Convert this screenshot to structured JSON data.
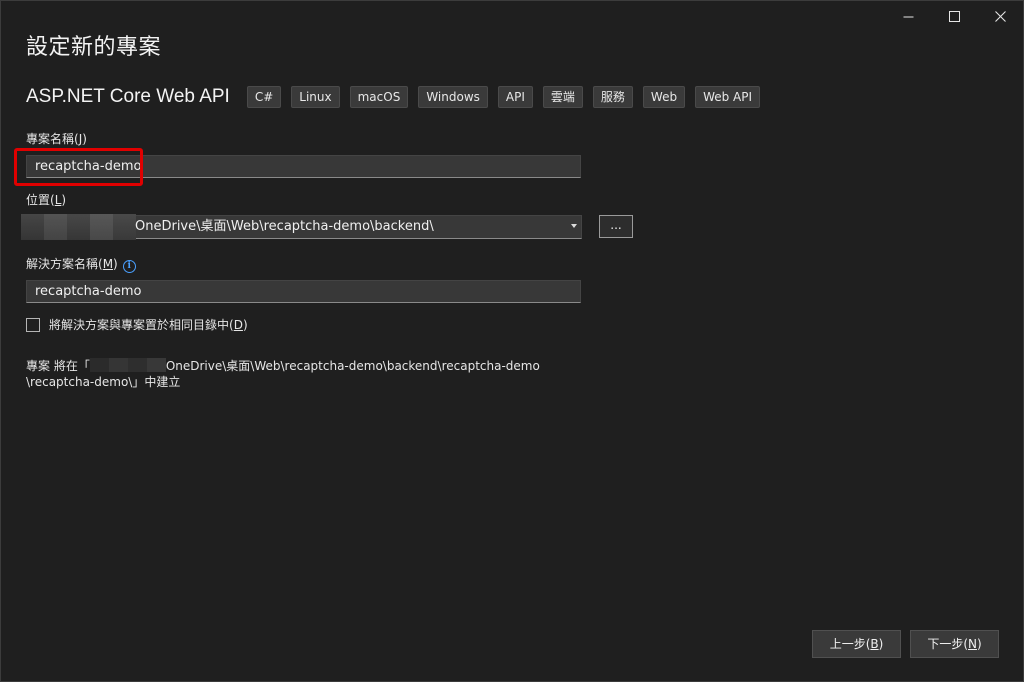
{
  "window": {
    "title": "設定新的專案",
    "controls": {
      "minimize": "minimize-icon",
      "maximize": "maximize-icon",
      "close": "close-icon"
    }
  },
  "template": {
    "name": "ASP.NET Core Web API",
    "tags": [
      "C#",
      "Linux",
      "macOS",
      "Windows",
      "API",
      "雲端",
      "服務",
      "Web",
      "Web API"
    ]
  },
  "project_name": {
    "label": "專案名稱(",
    "accel": "J",
    "label_end": ")",
    "value": "recaptcha-demo"
  },
  "location": {
    "label": "位置(",
    "accel": "L",
    "label_end": ")",
    "value": "OneDrive\\桌面\\Web\\recaptcha-demo\\backend\\",
    "browse_label": "..."
  },
  "solution_name": {
    "label": "解決方案名稱(",
    "accel": "M",
    "label_end": ")",
    "info_icon": "i",
    "value": "recaptcha-demo"
  },
  "same_dir": {
    "label": "將解決方案與專案置於相同目錄中(",
    "accel": "D",
    "label_end": ")",
    "checked": false
  },
  "summary": {
    "prefix": "專案 將在「",
    "path_line1": "OneDrive\\桌面\\Web\\recaptcha-demo\\backend\\recaptcha-demo",
    "path_line2": "\\recaptcha-demo\\」中建立"
  },
  "footer": {
    "back_label": "上一步(",
    "back_accel": "B",
    "back_end": ")",
    "next_label": "下一步(",
    "next_accel": "N",
    "next_end": ")"
  }
}
